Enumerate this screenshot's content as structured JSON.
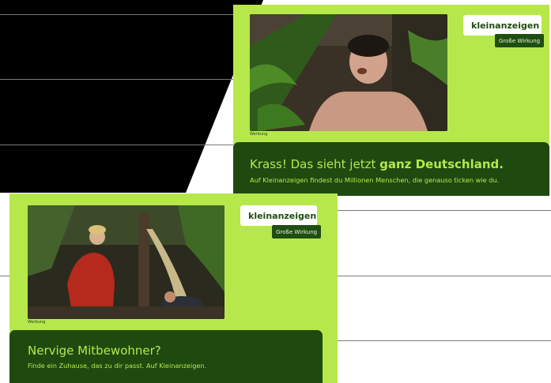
{
  "ads": [
    {
      "brand": "kleinanzeigen",
      "tag": "Große Wirkung",
      "werbung": "Werbung",
      "headline_plain": "Krass! Das sieht jetzt ",
      "headline_bold": "ganz Deutschland.",
      "subline": "Auf Kleinanzeigen findest du Millionen Menschen, die genauso ticken wie du."
    },
    {
      "brand": "kleinanzeigen",
      "tag": "Große Wirkung",
      "werbung": "Werbung",
      "headline_plain": "Nervige Mitbewohner?",
      "subline": "Finde ein Zuhause, das zu dir passt. Auf Kleinanzeigen."
    }
  ],
  "colors": {
    "ad_green": "#b6e84b",
    "panel_dark_green": "#1e4a10",
    "brand_green": "#1f4d12",
    "background": "#ffffff",
    "wedge": "#000000"
  },
  "icons": [
    "kleinanzeigen-logo-icon"
  ]
}
